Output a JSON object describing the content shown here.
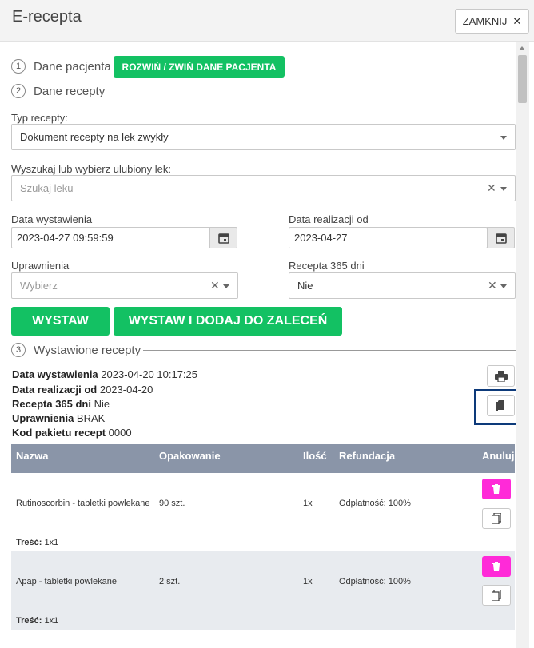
{
  "header": {
    "title": "E-recepta",
    "close_label": "ZAMKNIJ"
  },
  "steps": [
    {
      "num": "1",
      "label": "Dane pacjenta",
      "button": "ROZWIŃ / ZWIŃ DANE PACJENTA"
    },
    {
      "num": "2",
      "label": "Dane recepty"
    },
    {
      "num": "3",
      "label": "Wystawione recepty"
    }
  ],
  "form": {
    "typ_label": "Typ recepty:",
    "typ_value": "Dokument recepty na lek zwykły",
    "search_label": "Wyszukaj lub wybierz ulubiony lek:",
    "search_placeholder": "Szukaj leku",
    "data_wyst_label": "Data wystawienia",
    "data_wyst_value": "2023-04-27 09:59:59",
    "data_real_label": "Data realizacji od",
    "data_real_value": "2023-04-27",
    "upr_label": "Uprawnienia",
    "upr_placeholder": "Wybierz",
    "r365_label": "Recepta 365 dni",
    "r365_value": "Nie",
    "btn_wystaw": "WYSTAW",
    "btn_wystaw_dodaj": "WYSTAW I DODAJ DO ZALECEŃ"
  },
  "issued": {
    "rows": [
      {
        "key": "Data wystawienia",
        "value": "2023-04-20 10:17:25"
      },
      {
        "key": "Data realizacji od",
        "value": "2023-04-20"
      },
      {
        "key": "Recepta 365 dni",
        "value": "Nie"
      },
      {
        "key": "Uprawnienia",
        "value": "BRAK"
      },
      {
        "key": "Kod pakietu recept",
        "value": "0000"
      }
    ]
  },
  "table": {
    "headers": [
      "Nazwa",
      "Opakowanie",
      "Ilość",
      "Refundacja",
      "Anuluj"
    ],
    "rows": [
      {
        "nazwa": "Rutinoscorbin - tabletki powlekane",
        "opakowanie": "90 szt.",
        "ilosc": "1x",
        "refundacja": "Odpłatność: 100%",
        "tresc_label": "Treść:",
        "tresc": "1x1"
      },
      {
        "nazwa": "Apap - tabletki powlekane",
        "opakowanie": "2 szt.",
        "ilosc": "1x",
        "refundacja": "Odpłatność: 100%",
        "tresc_label": "Treść:",
        "tresc": "1x1"
      }
    ]
  },
  "colors": {
    "green": "#13c163",
    "magenta": "#ff2ad8",
    "table_header": "#8a95a8",
    "focus_outline": "#0d3a7a"
  }
}
